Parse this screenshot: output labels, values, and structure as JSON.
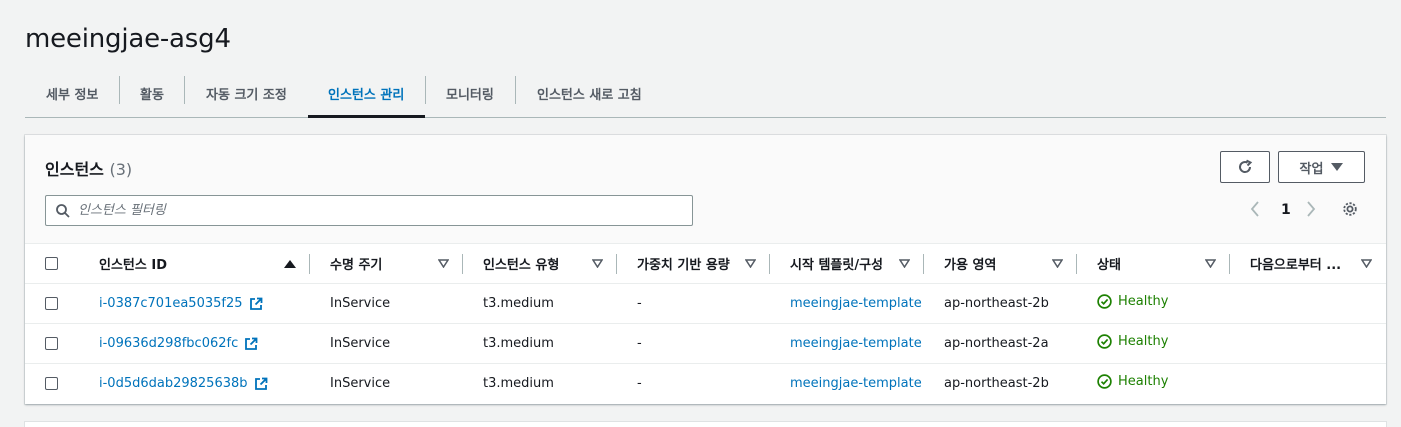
{
  "page": {
    "title": "meeingjae-asg4"
  },
  "tabs": [
    {
      "label": "세부 정보",
      "active": false
    },
    {
      "label": "활동",
      "active": false
    },
    {
      "label": "자동 크기 조정",
      "active": false
    },
    {
      "label": "인스턴스 관리",
      "active": true
    },
    {
      "label": "모니터링",
      "active": false
    },
    {
      "label": "인스턴스 새로 고침",
      "active": false
    }
  ],
  "panel": {
    "title": "인스턴스",
    "count": "(3)",
    "actions_label": "작업",
    "search_placeholder": "인스턴스 필터링",
    "page_number": "1"
  },
  "columns": [
    {
      "label": "인스턴스 ID",
      "sort": "ascending"
    },
    {
      "label": "수명 주기",
      "sort": "none"
    },
    {
      "label": "인스턴스 유형",
      "sort": "none"
    },
    {
      "label": "가중치 기반 용량",
      "sort": "none"
    },
    {
      "label": "시작 템플릿/구성",
      "sort": "none"
    },
    {
      "label": "가용 영역",
      "sort": "none"
    },
    {
      "label": "상태",
      "sort": "none"
    },
    {
      "label": "다음으로부터 ...",
      "sort": "none"
    }
  ],
  "rows": [
    {
      "id": "i-0387c701ea5035f25",
      "lifecycle": "InService",
      "type": "t3.medium",
      "weight": "-",
      "template": "meeingjae-template",
      "az": "ap-northeast-2b",
      "status": "Healthy",
      "since": ""
    },
    {
      "id": "i-09636d298fbc062fc",
      "lifecycle": "InService",
      "type": "t3.medium",
      "weight": "-",
      "template": "meeingjae-template",
      "az": "ap-northeast-2a",
      "status": "Healthy",
      "since": ""
    },
    {
      "id": "i-0d5d6dab29825638b",
      "lifecycle": "InService",
      "type": "t3.medium",
      "weight": "-",
      "template": "meeingjae-template",
      "az": "ap-northeast-2b",
      "status": "Healthy",
      "since": ""
    }
  ],
  "colors": {
    "link": "#0073bb",
    "healthy": "#1d8102",
    "text": "#16191f",
    "muted": "#545b64"
  },
  "icons": {
    "refresh": "refresh-icon",
    "caret": "caret-down-icon",
    "search": "search-icon",
    "settings": "gear-icon",
    "external": "external-link-icon",
    "status": "check-circle-icon"
  }
}
